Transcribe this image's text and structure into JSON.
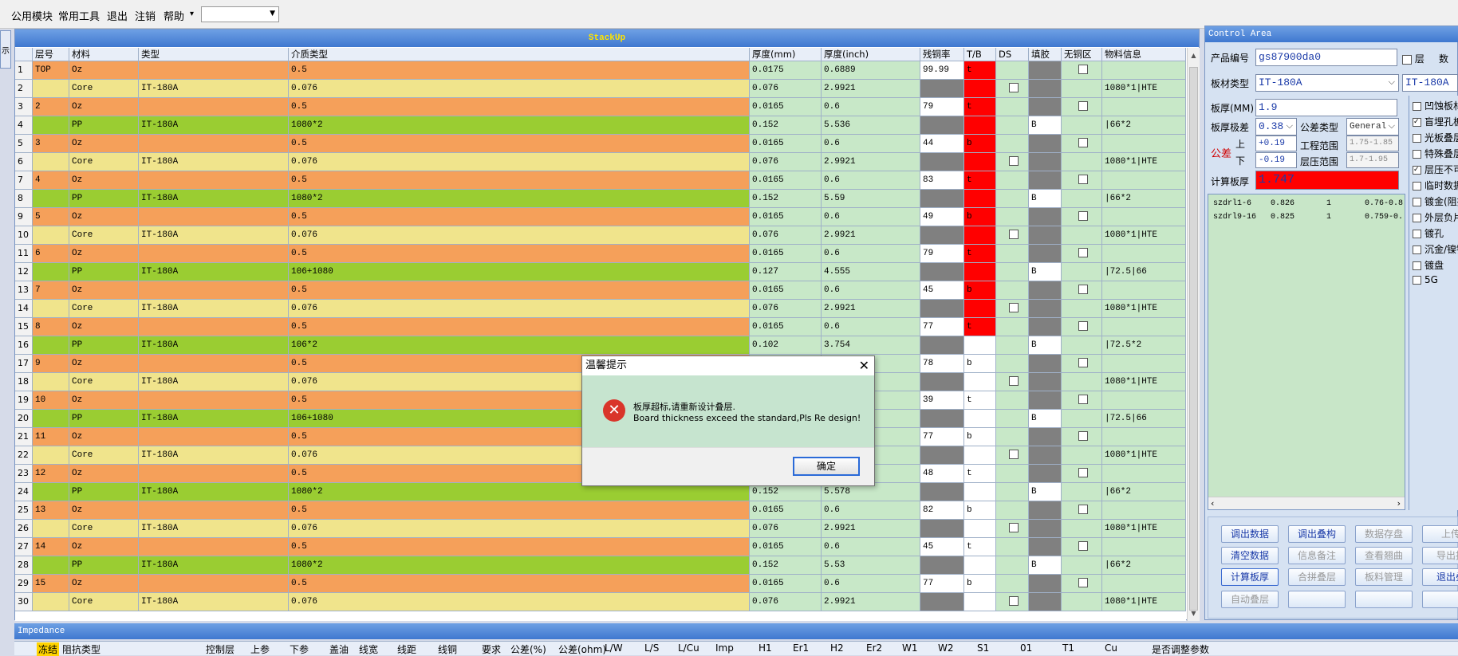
{
  "menu": {
    "items": [
      "公用模块",
      "常用工具",
      "退出",
      "注销",
      "帮助"
    ],
    "help_arrow": "▾"
  },
  "leftstub": {
    "label": "示"
  },
  "stackup": {
    "title": "StackUp",
    "headers": [
      "层号",
      "材料",
      "类型",
      "介质类型",
      "厚度(mm)",
      "厚度(inch)",
      "残铜率",
      "T/B",
      "DS",
      "填胶",
      "无铜区",
      "物料信息"
    ],
    "rows": [
      [
        "1",
        "TOP",
        "Oz",
        "",
        "0.5",
        "0.0175",
        "0.6889",
        "99.99",
        "t",
        "",
        "",
        "",
        ""
      ],
      [
        "2",
        "",
        "Core",
        "IT-180A",
        "0.076",
        "0.076",
        "2.9921",
        "",
        "",
        "x",
        "",
        "",
        "1080*1|HTE"
      ],
      [
        "3",
        "2",
        "Oz",
        "",
        "0.5",
        "0.0165",
        "0.6",
        "79",
        "t",
        "",
        "",
        "",
        ""
      ],
      [
        "4",
        "",
        "PP",
        "IT-180A",
        "1080*2",
        "0.152",
        "5.536",
        "",
        "",
        "",
        "B",
        "",
        "|66*2"
      ],
      [
        "5",
        "3",
        "Oz",
        "",
        "0.5",
        "0.0165",
        "0.6",
        "44",
        "b",
        "",
        "",
        "",
        ""
      ],
      [
        "6",
        "",
        "Core",
        "IT-180A",
        "0.076",
        "0.076",
        "2.9921",
        "",
        "",
        "x",
        "",
        "",
        "1080*1|HTE"
      ],
      [
        "7",
        "4",
        "Oz",
        "",
        "0.5",
        "0.0165",
        "0.6",
        "83",
        "t",
        "",
        "",
        "",
        ""
      ],
      [
        "8",
        "",
        "PP",
        "IT-180A",
        "1080*2",
        "0.152",
        "5.59",
        "",
        "",
        "",
        "B",
        "",
        "|66*2"
      ],
      [
        "9",
        "5",
        "Oz",
        "",
        "0.5",
        "0.0165",
        "0.6",
        "49",
        "b",
        "",
        "",
        "",
        ""
      ],
      [
        "10",
        "",
        "Core",
        "IT-180A",
        "0.076",
        "0.076",
        "2.9921",
        "",
        "",
        "x",
        "",
        "",
        "1080*1|HTE"
      ],
      [
        "11",
        "6",
        "Oz",
        "",
        "0.5",
        "0.0165",
        "0.6",
        "79",
        "t",
        "",
        "",
        "",
        ""
      ],
      [
        "12",
        "",
        "PP",
        "IT-180A",
        "106+1080",
        "0.127",
        "4.555",
        "",
        "",
        "",
        "B",
        "",
        "|72.5|66"
      ],
      [
        "13",
        "7",
        "Oz",
        "",
        "0.5",
        "0.0165",
        "0.6",
        "45",
        "b",
        "",
        "",
        "",
        ""
      ],
      [
        "14",
        "",
        "Core",
        "IT-180A",
        "0.076",
        "0.076",
        "2.9921",
        "",
        "",
        "x",
        "",
        "",
        "1080*1|HTE"
      ],
      [
        "15",
        "8",
        "Oz",
        "",
        "0.5",
        "0.0165",
        "0.6",
        "77",
        "t",
        "",
        "",
        "",
        ""
      ],
      [
        "16",
        "",
        "PP",
        "IT-180A",
        "106*2",
        "0.102",
        "3.754",
        "",
        "",
        "",
        "B",
        "",
        "|72.5*2"
      ],
      [
        "17",
        "9",
        "Oz",
        "",
        "0.5",
        "",
        "",
        "78",
        "b",
        "",
        "",
        "",
        ""
      ],
      [
        "18",
        "",
        "Core",
        "IT-180A",
        "0.076",
        "",
        "",
        "",
        "",
        "x",
        "",
        "",
        "1080*1|HTE"
      ],
      [
        "19",
        "10",
        "Oz",
        "",
        "0.5",
        "",
        "",
        "39",
        "t",
        "",
        "",
        "",
        ""
      ],
      [
        "20",
        "",
        "PP",
        "IT-180A",
        "106+1080",
        "",
        "",
        "",
        "",
        "",
        "B",
        "",
        "|72.5|66"
      ],
      [
        "21",
        "11",
        "Oz",
        "",
        "0.5",
        "",
        "",
        "77",
        "b",
        "",
        "",
        "",
        ""
      ],
      [
        "22",
        "",
        "Core",
        "IT-180A",
        "0.076",
        "",
        "",
        "",
        "",
        "x",
        "",
        "",
        "1080*1|HTE"
      ],
      [
        "23",
        "12",
        "Oz",
        "",
        "0.5",
        "",
        "",
        "48",
        "t",
        "",
        "",
        "",
        ""
      ],
      [
        "24",
        "",
        "PP",
        "IT-180A",
        "1080*2",
        "0.152",
        "5.578",
        "",
        "",
        "",
        "B",
        "",
        "|66*2"
      ],
      [
        "25",
        "13",
        "Oz",
        "",
        "0.5",
        "0.0165",
        "0.6",
        "82",
        "b",
        "",
        "",
        "",
        ""
      ],
      [
        "26",
        "",
        "Core",
        "IT-180A",
        "0.076",
        "0.076",
        "2.9921",
        "",
        "",
        "x",
        "",
        "",
        "1080*1|HTE"
      ],
      [
        "27",
        "14",
        "Oz",
        "",
        "0.5",
        "0.0165",
        "0.6",
        "45",
        "t",
        "",
        "",
        "",
        ""
      ],
      [
        "28",
        "",
        "PP",
        "IT-180A",
        "1080*2",
        "0.152",
        "5.53",
        "",
        "",
        "",
        "B",
        "",
        "|66*2"
      ],
      [
        "29",
        "15",
        "Oz",
        "",
        "0.5",
        "0.0165",
        "0.6",
        "77",
        "b",
        "",
        "",
        "",
        ""
      ],
      [
        "30",
        "",
        "Core",
        "IT-180A",
        "0.076",
        "0.076",
        "2.9921",
        "",
        "",
        "x",
        "",
        "",
        "1080*1|HTE"
      ]
    ]
  },
  "impedance": {
    "title": "Impedance",
    "headers": [
      "冻结",
      "阻抗类型",
      "控制层",
      "上参",
      "下参",
      "盖油",
      "线宽",
      "线距",
      "线铜",
      "要求",
      "公差(%)",
      "公差(ohm)",
      "L/W",
      "L/S",
      "L/Cu",
      "Imp",
      "H1",
      "Er1",
      "H2",
      "Er2",
      "W1",
      "W2",
      "S1",
      "01",
      "T1",
      "Cu",
      "是否调整参数"
    ]
  },
  "control": {
    "title": "Control Area",
    "product_label": "产品编号",
    "product_value": "gs87900da0",
    "layer_check": "层",
    "count_label": "数",
    "material_label": "板材类型",
    "material_value": "IT-180A",
    "material_value2": "IT-180A",
    "thick_label": "板厚(MM)",
    "thick_value": "1.9",
    "grade_label": "板厚极差",
    "grade_value": "0.38",
    "tol_type_label": "公差类型",
    "tol_type_value": "General",
    "tol_label": "公差",
    "up_label": "上",
    "down_label": "下",
    "tol_up": "+0.19",
    "tol_down": "-0.19",
    "eng_label": "工程范围",
    "eng_value": "1.75-1.85",
    "press_label": "层压范围",
    "press_value": "1.7-1.95",
    "calc_label": "计算板厚",
    "calc_value": "1.747",
    "list": [
      [
        "szdrl1-6",
        "0.826",
        "1",
        "0.76-0.8"
      ],
      [
        "szdrl9-16",
        "0.825",
        "1",
        "0.759-0."
      ]
    ],
    "checks": [
      [
        "凹蚀板材",
        false
      ],
      [
        "盲埋孔板",
        true
      ],
      [
        "光板叠层",
        false
      ],
      [
        "特殊叠层",
        false
      ],
      [
        "层压不可",
        true
      ],
      [
        "临时数据",
        false
      ],
      [
        "镀金(阻抗",
        false
      ],
      [
        "外层负片",
        false
      ],
      [
        "镀孔",
        false
      ],
      [
        "沉金/镍钯",
        false
      ],
      [
        "镀盘",
        false
      ],
      [
        "5G",
        false
      ]
    ],
    "buttons": [
      [
        "调出数据",
        "调出叠构",
        "数据存盘",
        "上传"
      ],
      [
        "清空数据",
        "信息备注",
        "查看翘曲",
        "导出报"
      ],
      [
        "计算板厚",
        "合拼叠层",
        "板料管理",
        "退出叠"
      ],
      [
        "自动叠层",
        "",
        "",
        ""
      ]
    ]
  },
  "dialog": {
    "title": "温馨提示",
    "close": "✕",
    "icon": "✕",
    "msg_cn": "板厚超标,请重新设计叠层.",
    "msg_en": "Board thickness exceed the standard,Pls Re design!",
    "ok": "确定"
  },
  "colors": {
    "oz": "#f5a05a",
    "core": "#f0e48c",
    "pp": "#9acd32",
    "green": "#c8e8c8",
    "red": "#ff0000",
    "gray": "#808080"
  }
}
